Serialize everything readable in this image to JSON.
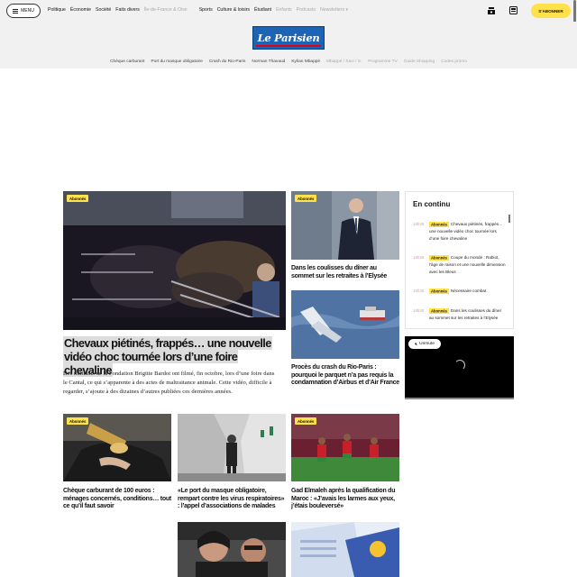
{
  "topbar": {
    "menu_label": "MENU",
    "nav": [
      "Politique",
      "Économie",
      "Société",
      "Faits divers",
      "Île-de-France & Oise",
      "Sports",
      "Culture & loisirs",
      "Étudiant",
      "Enfants",
      "Podcasts",
      "Newsletters"
    ],
    "subscribe_label": "S'ABONNER"
  },
  "header": {
    "logo_text": "Le Parisien"
  },
  "trends": [
    "Chèque carburant",
    "Port du masque obligatoire",
    "Crash du Rio-Paris",
    "Norman Thavaud",
    "Kylian Mbappé",
    "Mbappé / Xavi / S.",
    "Programme TV",
    "Guide Shopping",
    "Codes promo"
  ],
  "badge_label": "Abonnés",
  "hero": {
    "title": "Chevaux piétinés, frappés… une nouvelle vidéo choc tournée lors d’une foire chevaline",
    "description": "Des militants de la Fondation Brigitte Bardot ont filmé, fin octobre, lors d’une foire dans le Cantal, ce qui s’apparente à des actes de maltraitance animale. Cette vidéo, difficile à regarder, s’ajoute à des dizaines d’autres publiées ces dernières années."
  },
  "side_articles": [
    {
      "title": "Dans les coulisses du dîner au sommet sur les retraites à l’Elysée"
    },
    {
      "title": "Procès du crash du Rio-Paris : pourquoi le parquet n’a pas requis la condamnation d’Airbus et d’Air France"
    }
  ],
  "grid_articles": [
    {
      "title": "Chèque carburant de 100 euros : ménages concernés, conditions… tout ce qu’il faut savoir"
    },
    {
      "title": "«Le port du masque obligatoire, rempart contre les virus respiratoires» : l’appel d’associations de malades"
    },
    {
      "title": "Gad Elmaleh après la qualification du Maroc : «J’avais les larmes aux yeux, j’étais bouleversé»"
    }
  ],
  "en_continu": {
    "title": "En continu",
    "items": [
      {
        "time": "16h45",
        "text": "Chevaux piétinés, frappés… une nouvelle vidéo choc tournée lors d’une foire chevaline"
      },
      {
        "time": "16h45",
        "text": "Coupe du monde : Rabiot, l’âge de raison et une nouvelle dimension avec les Bleus"
      },
      {
        "time": "16h30",
        "text": "Nécessaire combat"
      },
      {
        "time": "16h30",
        "text": "Dans les coulisses du dîner au sommet sur les retraites à l’Elysée"
      }
    ]
  },
  "video": {
    "unmute_label": "Unmute"
  }
}
